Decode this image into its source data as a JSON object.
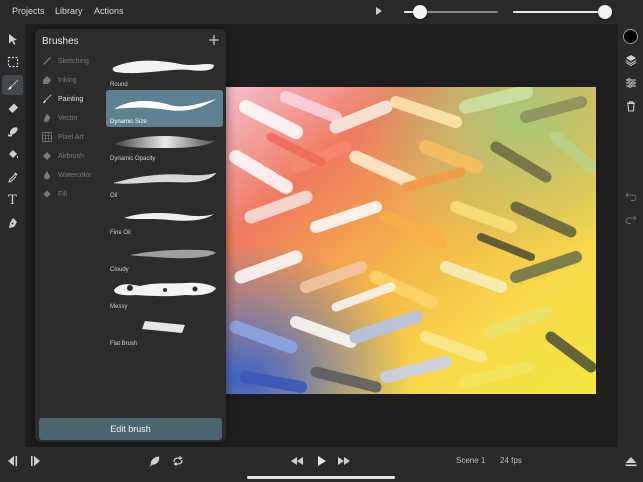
{
  "menu": {
    "projects": "Projects",
    "library": "Library",
    "actions": "Actions"
  },
  "top_controls": {
    "brush_size_level": 0.17,
    "opacity_level": 0.97
  },
  "left_tools": [
    {
      "icon": "select-arrow-icon"
    },
    {
      "icon": "marquee-selection-icon"
    },
    {
      "icon": "brush-icon",
      "active": true
    },
    {
      "icon": "eraser-icon"
    },
    {
      "icon": "smudge-icon"
    },
    {
      "icon": "paint-bucket-icon"
    },
    {
      "icon": "eyedropper-icon"
    },
    {
      "icon": "text-tool-icon",
      "glyph": "T"
    },
    {
      "icon": "pen-tool-icon"
    }
  ],
  "right_tools": {
    "color": "#000000",
    "items": [
      "layers-icon",
      "adjustments-icon",
      "trash-icon",
      "undo-icon",
      "redo-icon"
    ]
  },
  "brushes_panel": {
    "title": "Brushes",
    "categories": [
      {
        "label": "Sketching",
        "icon": "pencil-icon",
        "active": false
      },
      {
        "label": "Inking",
        "icon": "ink-pen-icon",
        "active": false
      },
      {
        "label": "Painting",
        "icon": "paintbrush-icon",
        "active": true
      },
      {
        "label": "Vector",
        "icon": "vector-pen-icon",
        "active": false
      },
      {
        "label": "Pixel Art",
        "icon": "pixel-grid-icon",
        "active": false
      },
      {
        "label": "Airbrush",
        "icon": "airbrush-icon",
        "active": false
      },
      {
        "label": "Watercolor",
        "icon": "water-drop-icon",
        "active": false
      },
      {
        "label": "Fill",
        "icon": "fill-bucket-icon",
        "active": false
      }
    ],
    "brushes": [
      {
        "label": "Round",
        "active": false
      },
      {
        "label": "Dynamic Size",
        "active": true
      },
      {
        "label": "Dynamic Opacity",
        "active": false
      },
      {
        "label": "Oil",
        "active": false
      },
      {
        "label": "Fine Oil",
        "active": false
      },
      {
        "label": "Cloudy",
        "active": false
      },
      {
        "label": "Messy",
        "active": false
      },
      {
        "label": "Flat Brush",
        "active": false
      }
    ],
    "edit_button": "Edit brush"
  },
  "bottom_bar": {
    "scene": "Scene 1",
    "fps": "24 fps"
  },
  "colors": {
    "accent": "#5d8190",
    "edit_button": "#4c6670",
    "chrome": "#2a2a2c"
  }
}
